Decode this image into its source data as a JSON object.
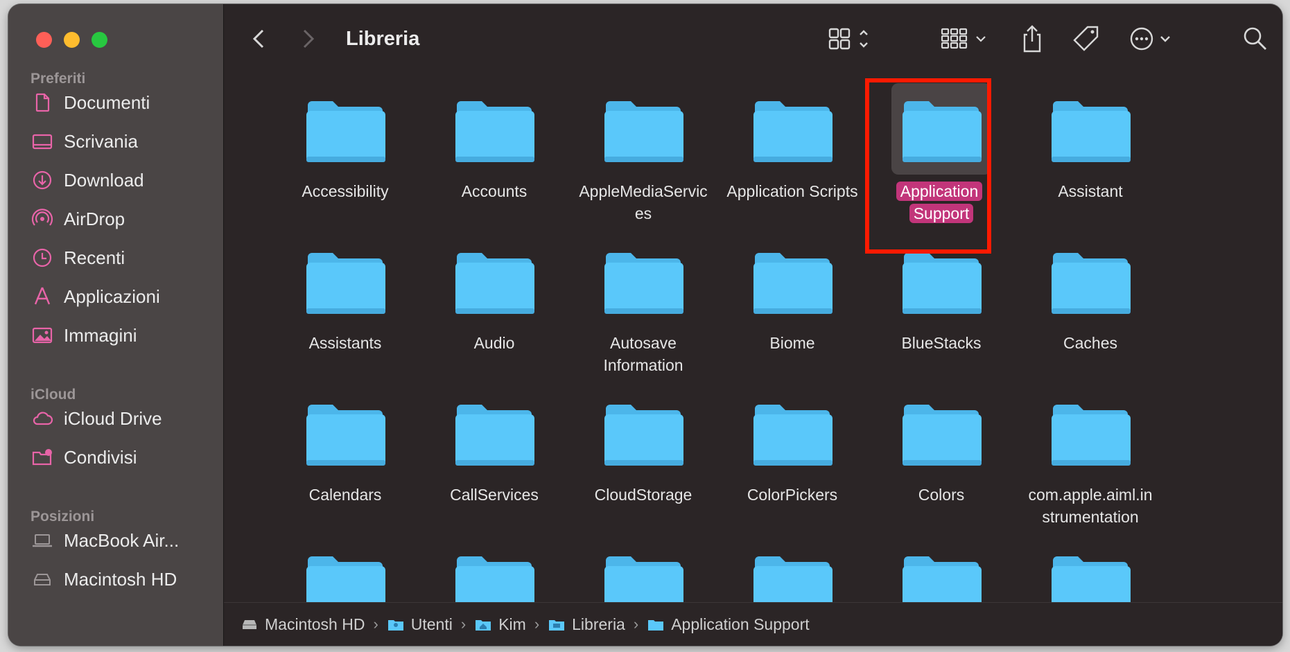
{
  "window": {
    "title": "Libreria",
    "traffic_lights": {
      "close": "#fe5f57",
      "minimize": "#febc2e",
      "zoom": "#28c840"
    }
  },
  "sidebar": {
    "sections": [
      {
        "title": "Preferiti",
        "items": [
          {
            "label": "Documenti",
            "icon": "document-icon"
          },
          {
            "label": "Scrivania",
            "icon": "desktop-icon"
          },
          {
            "label": "Download",
            "icon": "download-icon"
          },
          {
            "label": "AirDrop",
            "icon": "airdrop-icon"
          },
          {
            "label": "Recenti",
            "icon": "clock-icon"
          },
          {
            "label": "Applicazioni",
            "icon": "applications-icon"
          },
          {
            "label": "Immagini",
            "icon": "photo-icon"
          }
        ]
      },
      {
        "title": "iCloud",
        "items": [
          {
            "label": "iCloud Drive",
            "icon": "cloud-icon"
          },
          {
            "label": "Condivisi",
            "icon": "shared-folder-icon"
          }
        ]
      },
      {
        "title": "Posizioni",
        "items": [
          {
            "label": "MacBook Air...",
            "icon": "laptop-icon"
          },
          {
            "label": "Macintosh HD",
            "icon": "disk-icon"
          }
        ]
      }
    ],
    "accent_color": "#e864a8"
  },
  "folders": [
    {
      "name": "Accessibility"
    },
    {
      "name": "Accounts"
    },
    {
      "name": "AppleMediaServic es"
    },
    {
      "name": "Application Scripts"
    },
    {
      "name": "Application Support",
      "selected": true
    },
    {
      "name": "Assistant"
    },
    {
      "name": "Assistants"
    },
    {
      "name": "Audio"
    },
    {
      "name": "Autosave Information"
    },
    {
      "name": "Biome"
    },
    {
      "name": "BlueStacks"
    },
    {
      "name": "Caches"
    },
    {
      "name": "Calendars"
    },
    {
      "name": "CallServices"
    },
    {
      "name": "CloudStorage"
    },
    {
      "name": "ColorPickers"
    },
    {
      "name": "Colors"
    },
    {
      "name": "com.apple.aiml.in strumentation"
    },
    {
      "name": ""
    },
    {
      "name": ""
    },
    {
      "name": ""
    },
    {
      "name": ""
    },
    {
      "name": ""
    },
    {
      "name": ""
    }
  ],
  "pathbar": [
    {
      "label": "Macintosh HD",
      "icon": "disk-icon"
    },
    {
      "label": "Utenti",
      "icon": "users-folder-icon"
    },
    {
      "label": "Kim",
      "icon": "home-folder-icon"
    },
    {
      "label": "Libreria",
      "icon": "library-folder-icon"
    },
    {
      "label": "Application Support",
      "icon": "folder-icon"
    }
  ],
  "pathbar_separator": "›",
  "colors": {
    "folder": "#5ac8fa",
    "selection": "#c2357a",
    "highlight_box": "#ff1a00"
  }
}
